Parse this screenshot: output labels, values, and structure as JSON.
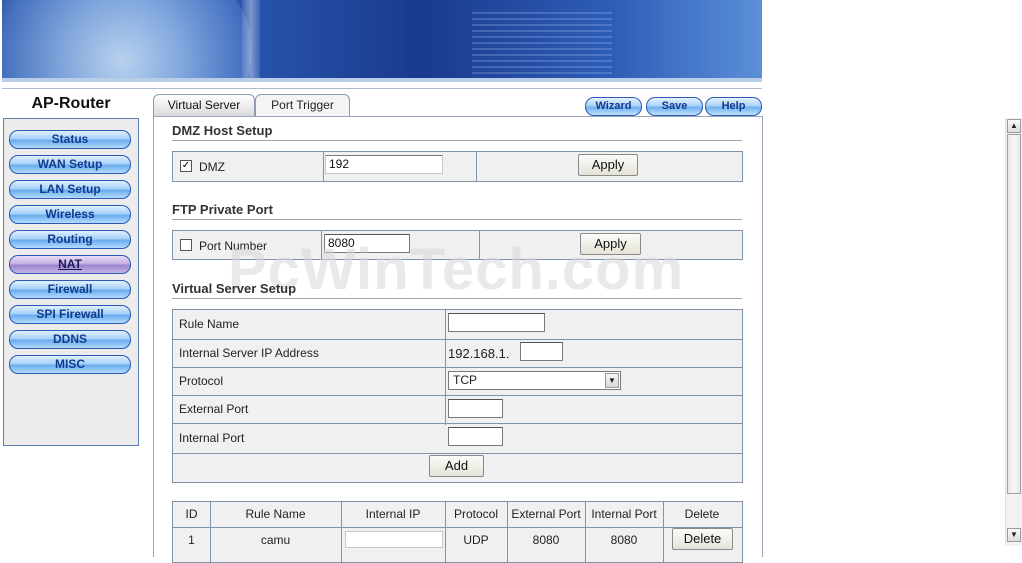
{
  "brand": "AP-Router",
  "nav": {
    "items": [
      {
        "label": "Status"
      },
      {
        "label": "WAN Setup"
      },
      {
        "label": "LAN Setup"
      },
      {
        "label": "Wireless"
      },
      {
        "label": "Routing"
      },
      {
        "label": "NAT",
        "active": true
      },
      {
        "label": "Firewall"
      },
      {
        "label": "SPI Firewall"
      },
      {
        "label": "DDNS"
      },
      {
        "label": "MISC"
      }
    ]
  },
  "tabs": [
    {
      "label": "Virtual Server",
      "active": true
    },
    {
      "label": "Port Trigger",
      "active": false
    }
  ],
  "toolbar": {
    "wizard": "Wizard",
    "save": "Save",
    "help": "Help"
  },
  "dmz": {
    "title": "DMZ Host Setup",
    "checkbox_label": "DMZ",
    "checked": true,
    "ip_value": "192",
    "apply": "Apply"
  },
  "ftp": {
    "title": "FTP Private Port",
    "checkbox_label": "Port Number",
    "checked": false,
    "port_value": "8080",
    "apply": "Apply"
  },
  "virtual_server": {
    "title": "Virtual Server Setup",
    "rule_name_label": "Rule Name",
    "ip_label": "Internal Server IP Address",
    "ip_prefix": "192.168.1.",
    "protocol_label": "Protocol",
    "protocol_value": "TCP",
    "external_port_label": "External Port",
    "internal_port_label": "Internal Port",
    "add": "Add"
  },
  "rules_table": {
    "headers": [
      "ID",
      "Rule Name",
      "Internal IP",
      "Protocol",
      "External Port",
      "Internal Port",
      "Delete"
    ],
    "rows": [
      {
        "id": "1",
        "rule_name": "camu",
        "internal_ip": "",
        "protocol": "UDP",
        "external_port": "8080",
        "internal_port": "8080",
        "delete": "Delete"
      }
    ]
  },
  "watermark": "PcWinTech.com",
  "colors": {
    "nav_blue": "#6aacee",
    "nav_active": "#9b83cf",
    "border": "#7f93ad"
  }
}
